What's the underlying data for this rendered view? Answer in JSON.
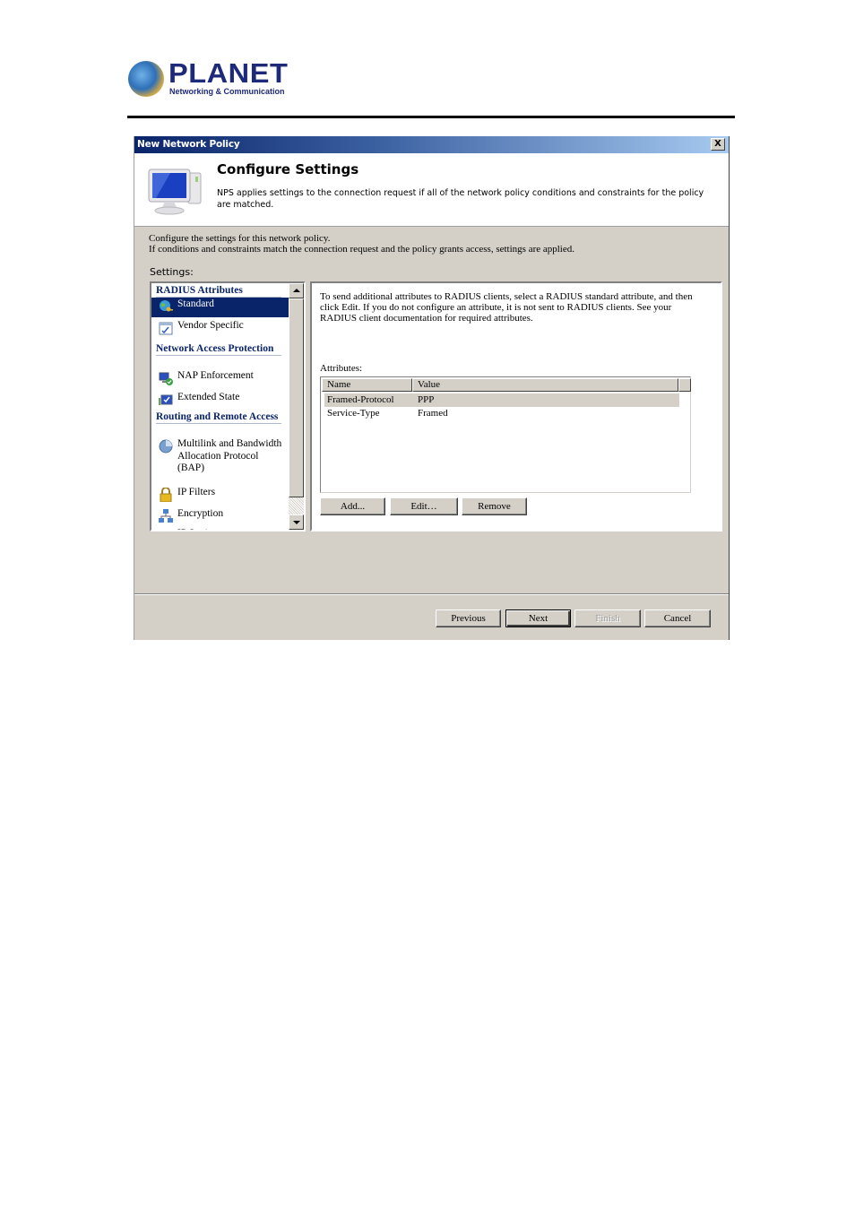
{
  "page_header": {
    "brand": "PLANET",
    "tagline": "Networking & Communication"
  },
  "dialog": {
    "title": "New Network Policy",
    "close_label": "X",
    "banner": {
      "title": "Configure Settings",
      "description": "NPS applies settings to the connection request if all of the network policy conditions and constraints for the policy are matched."
    },
    "intro_line1": "Configure the settings for this network policy.",
    "intro_line2": "If conditions and constraints match the connection request and the policy grants access, settings are applied.",
    "settings_label": "Settings:",
    "nav": {
      "groups": [
        {
          "title": "RADIUS Attributes"
        },
        {
          "title": "Network Access Protection"
        },
        {
          "title": "Routing and Remote Access"
        }
      ],
      "items": [
        {
          "label": "Standard",
          "icon": "globe-key-icon",
          "selected": true
        },
        {
          "label": "Vendor Specific",
          "icon": "checklist-icon",
          "selected": false
        },
        {
          "label": "NAP Enforcement",
          "icon": "computer-shield-icon",
          "selected": false
        },
        {
          "label": "Extended State",
          "icon": "monitor-check-icon",
          "selected": false
        },
        {
          "label": "Multilink and Bandwidth Allocation Protocol (BAP)",
          "icon": "pie-chart-icon",
          "selected": false
        },
        {
          "label": "IP Filters",
          "icon": "padlock-icon",
          "selected": false
        },
        {
          "label": "Encryption",
          "icon": "network-icon",
          "selected": false
        },
        {
          "label": "IP Settings",
          "icon": "ip-settings-icon",
          "selected": false
        }
      ]
    },
    "panel": {
      "description": "To send additional attributes to RADIUS clients, select a RADIUS standard attribute, and then click Edit. If you do not configure an attribute, it is not sent to RADIUS clients. See your RADIUS client documentation for required attributes.",
      "attributes_label": "Attributes:",
      "columns": [
        "Name",
        "Value"
      ],
      "rows": [
        {
          "name": "Framed-Protocol",
          "value": "PPP",
          "selected": true
        },
        {
          "name": "Service-Type",
          "value": "Framed",
          "selected": false
        }
      ],
      "buttons": {
        "add": "Add...",
        "edit": "Edit…",
        "remove": "Remove"
      }
    },
    "footer": {
      "previous": "Previous",
      "next": "Next",
      "finish": "Finish",
      "cancel": "Cancel"
    }
  }
}
